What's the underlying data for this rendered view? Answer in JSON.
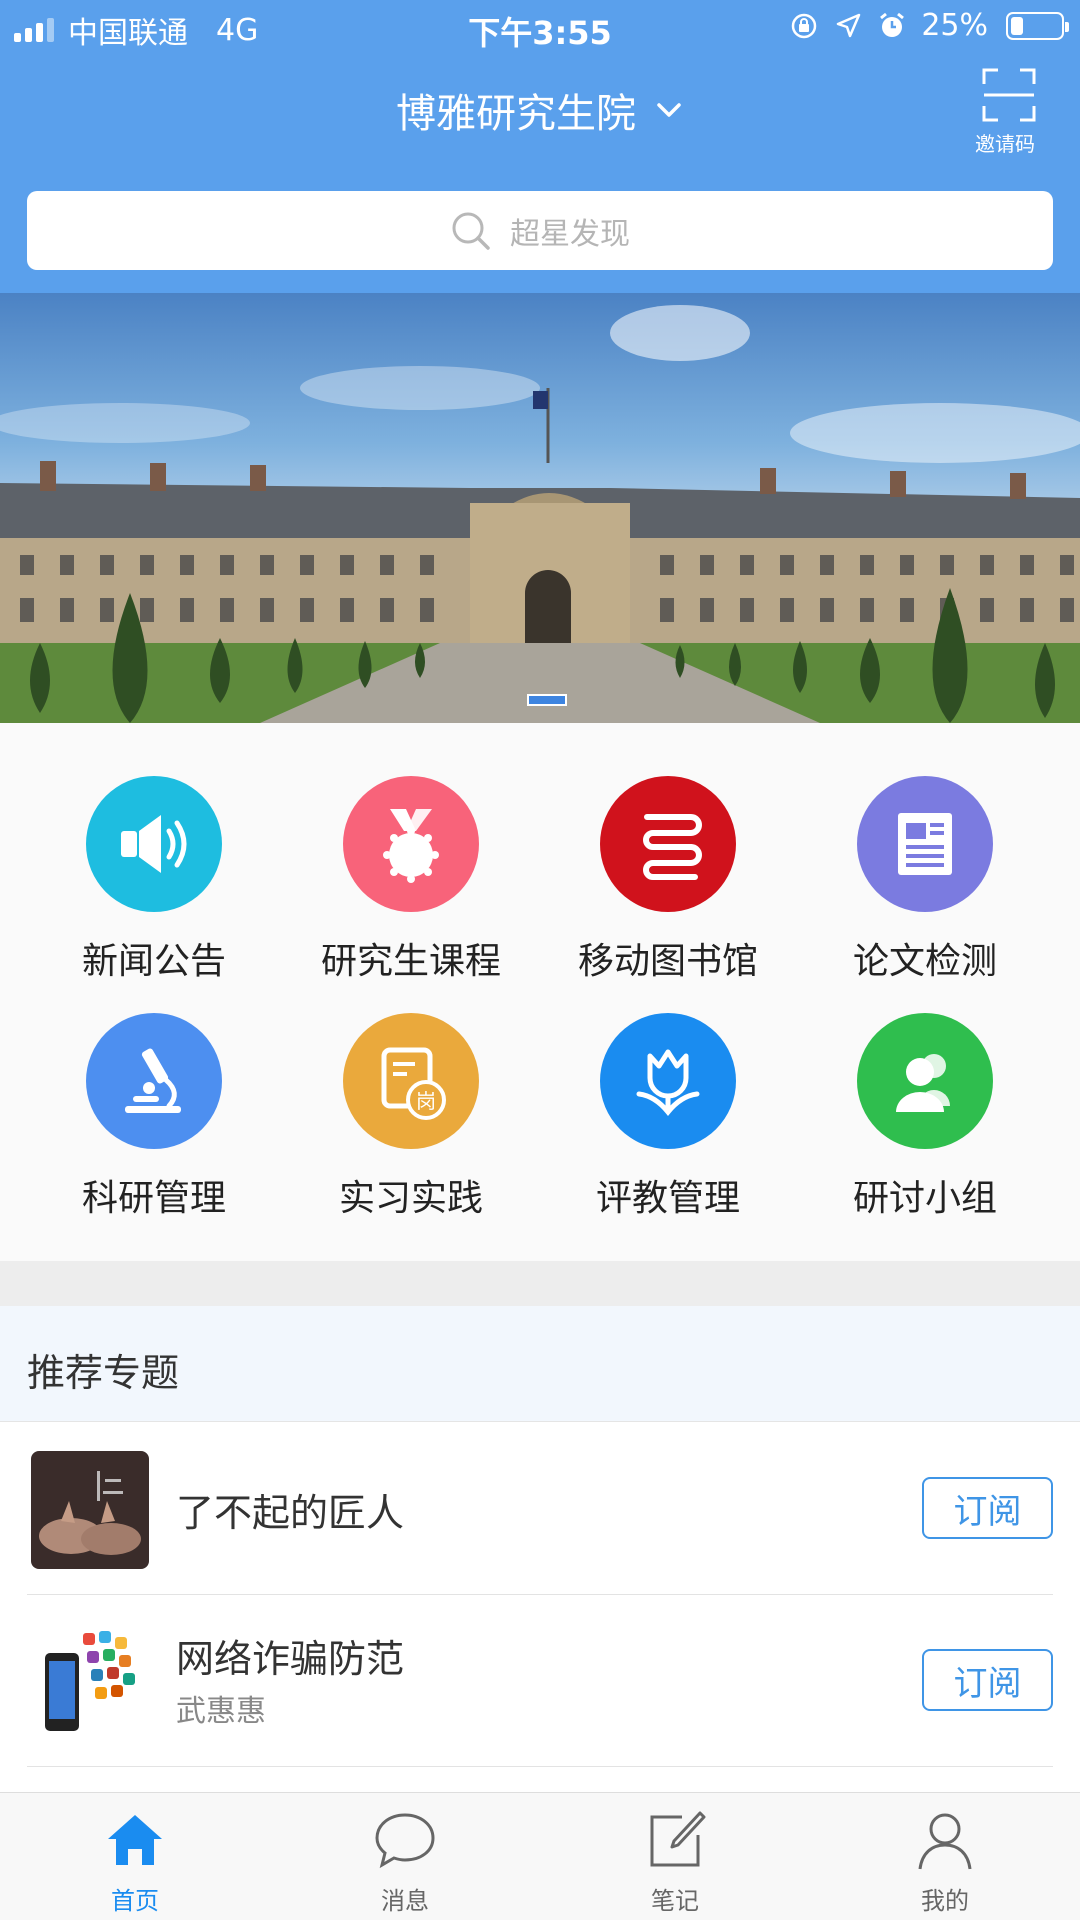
{
  "status_bar": {
    "carrier": "中国联通",
    "network": "4G",
    "time": "下午3:55",
    "battery": "25%",
    "battery_level": 0.25
  },
  "header": {
    "title": "博雅研究生院",
    "invite_label": "邀请码"
  },
  "search": {
    "placeholder": "超星发现"
  },
  "banner": {
    "slide_count": 1,
    "active_slide": 1
  },
  "grid": [
    {
      "label": "新闻公告",
      "icon": "speaker-icon",
      "color": "#1ebde0"
    },
    {
      "label": "研究生课程",
      "icon": "medal-icon",
      "color": "#f8637a"
    },
    {
      "label": "移动图书馆",
      "icon": "books-icon",
      "color": "#d0121c"
    },
    {
      "label": "论文检测",
      "icon": "document-icon",
      "color": "#7b7be0"
    },
    {
      "label": "科研管理",
      "icon": "microscope-icon",
      "color": "#4d8ff0"
    },
    {
      "label": "实习实践",
      "icon": "internship-icon",
      "color": "#eaa93c"
    },
    {
      "label": "评教管理",
      "icon": "tulip-icon",
      "color": "#1a8cf0"
    },
    {
      "label": "研讨小组",
      "icon": "group-icon",
      "color": "#2fbe4e"
    }
  ],
  "internship_badge": "岗",
  "recommended": {
    "title": "推荐专题",
    "items": [
      {
        "name": "了不起的匠人",
        "author": "",
        "button": "订阅"
      },
      {
        "name": "网络诈骗防范",
        "author": "武惠惠",
        "button": "订阅"
      }
    ]
  },
  "tabs": [
    {
      "label": "首页",
      "icon": "home-icon",
      "active": true
    },
    {
      "label": "消息",
      "icon": "chat-bubble-icon",
      "active": false
    },
    {
      "label": "笔记",
      "icon": "edit-note-icon",
      "active": false
    },
    {
      "label": "我的",
      "icon": "profile-icon",
      "active": false
    }
  ],
  "colors": {
    "header_bg": "#5aa0ec",
    "accent": "#1a8cf0",
    "subscribe_border": "#3f95e6"
  }
}
